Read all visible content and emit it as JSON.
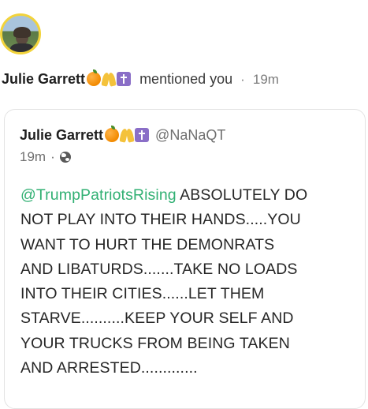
{
  "notification": {
    "author_name": "Julie Garrett",
    "action": "mentioned you",
    "separator": "·",
    "time": "19m"
  },
  "quoted_post": {
    "author_name": "Julie Garrett",
    "handle": "@NaNaQT",
    "time": "19m",
    "separator": "·",
    "visibility_icon": "globe-icon",
    "mention": "@TrumpPatriotsRising",
    "lines": [
      "ABSOLUTELY DO",
      "NOT PLAY INTO THEIR HANDS.....YOU",
      "WANT TO HURT THE DEMONRATS",
      "AND LIBATURDS.......TAKE NO LOADS",
      "INTO THEIR CITIES......LET THEM",
      "STARVE..........KEEP YOUR SELF AND",
      "YOUR TRUCKS FROM BEING TAKEN",
      "AND ARRESTED............."
    ]
  },
  "emoji_names": [
    "orange-emoji",
    "praying-hands-emoji",
    "latin-cross-emoji"
  ],
  "colors": {
    "mention": "#31b073",
    "avatar_ring": "#f2d33b",
    "meta_text": "#707070"
  }
}
